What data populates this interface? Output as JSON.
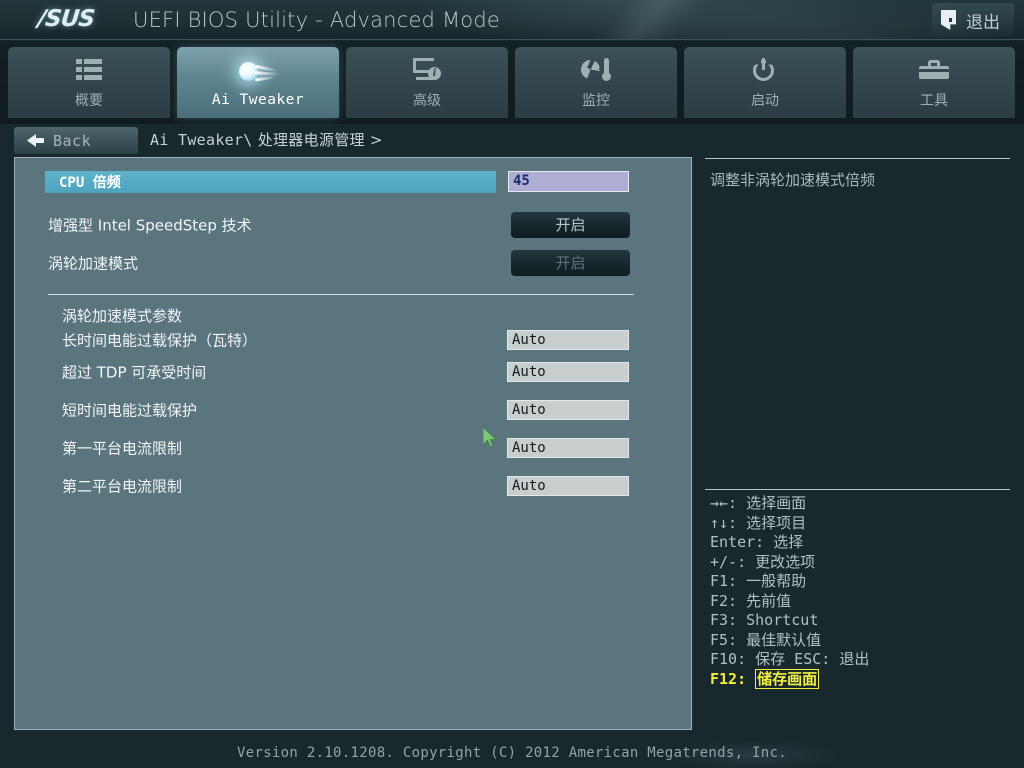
{
  "header": {
    "brand": "/SUS",
    "title": "UEFI BIOS Utility - Advanced Mode",
    "exit_label": "退出",
    "exit_icon": "exit-door-icon"
  },
  "tabs": [
    {
      "label": "概要",
      "icon": "list-icon",
      "active": false
    },
    {
      "label": "Ai Tweaker",
      "icon": "comet-icon",
      "active": true
    },
    {
      "label": "高级",
      "icon": "monitor-info-icon",
      "active": false
    },
    {
      "label": "监控",
      "icon": "gauge-thermometer-icon",
      "active": false
    },
    {
      "label": "启动",
      "icon": "power-icon",
      "active": false
    },
    {
      "label": "工具",
      "icon": "toolbox-icon",
      "active": false
    }
  ],
  "navbar": {
    "back_label": "Back",
    "back_icon": "back-arrow-icon",
    "breadcrumb_root": "Ai Tweaker\\",
    "breadcrumb_current": " 处理器电源管理 >"
  },
  "settings": [
    {
      "label": "CPU 倍频",
      "value": "45",
      "kind": "input-selected"
    },
    {
      "label": "增强型 Intel SpeedStep 技术",
      "value": "开启",
      "kind": "button"
    },
    {
      "label": "涡轮加速模式",
      "value": "开启",
      "kind": "button-disabled"
    },
    {
      "label": "长时间电能过载保护（瓦特）",
      "value": "Auto",
      "kind": "field"
    },
    {
      "label": "超过 TDP 可承受时间",
      "value": "Auto",
      "kind": "field"
    },
    {
      "label": "短时间电能过载保护",
      "value": "Auto",
      "kind": "field"
    },
    {
      "label": "第一平台电流限制",
      "value": "Auto",
      "kind": "field"
    },
    {
      "label": "第二平台电流限制",
      "value": "Auto",
      "kind": "field"
    }
  ],
  "group_caption": "涡轮加速模式参数",
  "help": {
    "description": "调整非涡轮加速模式倍频"
  },
  "legend": [
    "→←: 选择画面",
    "↑↓: 选择项目",
    "Enter: 选择",
    "+/-: 更改选项",
    "F1: 一般帮助",
    "F2: 先前值",
    "F3: Shortcut",
    "F5: 最佳默认值",
    "F10: 保存  ESC: 退出"
  ],
  "legend_highlight": {
    "key": "F12: ",
    "boxed": "储存画面"
  },
  "footer": {
    "text": "Version 2.10.1208. Copyright (C) 2012 American Megatrends, Inc."
  },
  "colors": {
    "panel_bg": "#5a757d",
    "selection": "#4ea3bd",
    "value_box": "#aeaed4",
    "accent_yellow": "#f2ef43",
    "app_bg": "#18282c"
  }
}
